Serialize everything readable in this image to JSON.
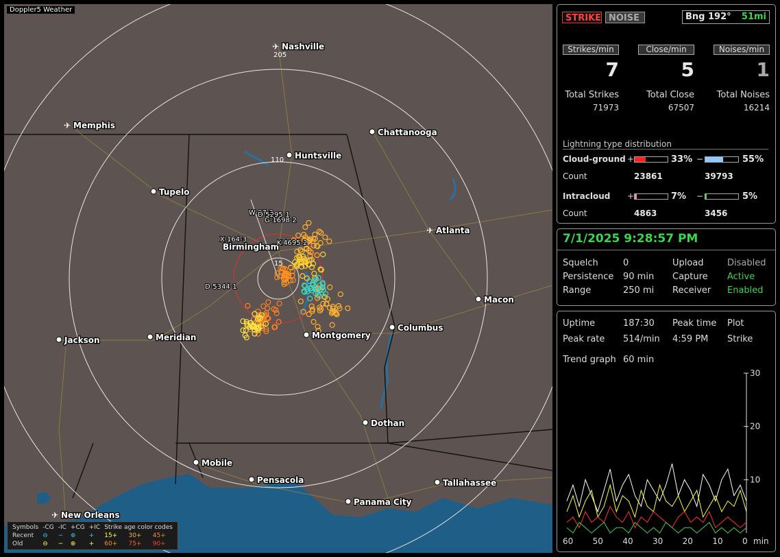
{
  "app": {
    "title": "Doppler5 Weather"
  },
  "map": {
    "range_labels": [
      "205",
      "110",
      "15"
    ],
    "cities": [
      {
        "name": "Nashville",
        "kind": "airport"
      },
      {
        "name": "Memphis",
        "kind": "airport"
      },
      {
        "name": "Chattanooga",
        "kind": "city"
      },
      {
        "name": "Huntsville",
        "kind": "city"
      },
      {
        "name": "Tupelo",
        "kind": "city"
      },
      {
        "name": "Atlanta",
        "kind": "airport"
      },
      {
        "name": "Birmingham",
        "kind": "city"
      },
      {
        "name": "Macon",
        "kind": "city"
      },
      {
        "name": "Columbus",
        "kind": "city"
      },
      {
        "name": "Montgomery",
        "kind": "city"
      },
      {
        "name": "Meridian",
        "kind": "city"
      },
      {
        "name": "Jackson",
        "kind": "city"
      },
      {
        "name": "Dothan",
        "kind": "city"
      },
      {
        "name": "Mobile",
        "kind": "city"
      },
      {
        "name": "Pensacola",
        "kind": "city"
      },
      {
        "name": "Tallahassee",
        "kind": "city"
      },
      {
        "name": "Panama City",
        "kind": "city"
      },
      {
        "name": "New Orleans",
        "kind": "airport"
      }
    ],
    "cell_labels": [
      "W-87-3",
      "D-5295-1",
      "G-1698-2",
      "X-164-3",
      "K-4695-2",
      "D-5344-1"
    ],
    "legend": {
      "symbols_label": "Symbols",
      "cols": [
        "-CG",
        "-IC",
        "+CG",
        "+IC"
      ],
      "age_label": "Strike age color codes",
      "recent_label": "Recent",
      "old_label": "Old",
      "recent_ages": [
        "15+",
        "30+",
        "45+"
      ],
      "old_ages": [
        "60+",
        "75+",
        "90+"
      ]
    }
  },
  "panel": {
    "strike_btn": "STRIKE",
    "noise_btn": "NOISE",
    "bearing": "Bng 192°",
    "bearing_dist": "51mi",
    "rate_labels": [
      "Strikes/min",
      "Close/min",
      "Noises/min"
    ],
    "rate_values": [
      "7",
      "5",
      "1"
    ],
    "total_labels": [
      "Total Strikes",
      "Total Close",
      "Total Noises"
    ],
    "total_values": [
      "71973",
      "67507",
      "16214"
    ],
    "dist_title": "Lightning type distribution",
    "cg_label": "Cloud-ground",
    "ic_label": "Intracloud",
    "count_label": "Count",
    "plus": "+",
    "minus": "−",
    "cg_pos_pct": "33%",
    "cg_neg_pct": "55%",
    "cg_pos_count": "23861",
    "cg_neg_count": "39793",
    "ic_pos_pct": "7%",
    "ic_neg_pct": "5%",
    "ic_pos_count": "4863",
    "ic_neg_count": "3456",
    "cg_pos_frac": 0.33,
    "cg_neg_frac": 0.55,
    "ic_pos_frac": 0.07,
    "ic_neg_frac": 0.05
  },
  "status": {
    "datetime": "7/1/2025 9:28:57 PM",
    "squelch_label": "Squelch",
    "squelch": "0",
    "persistence_label": "Persistence",
    "persistence": "90 min",
    "range_label": "Range",
    "range": "250 mi",
    "upload_label": "Upload",
    "upload": "Disabled",
    "capture_label": "Capture",
    "capture": "Active",
    "receiver_label": "Receiver",
    "receiver": "Enabled"
  },
  "stats": {
    "uptime_label": "Uptime",
    "uptime": "187:30",
    "peak_time_label": "Peak time",
    "peak_time": "4:59 PM",
    "plot_label": "Plot",
    "plot": "Strike",
    "peak_rate_label": "Peak rate",
    "peak_rate": "514/min",
    "trend_label": "Trend graph",
    "trend": "60 min"
  },
  "chart_data": {
    "type": "line",
    "x_ticks": [
      "60",
      "50",
      "40",
      "30",
      "20",
      "10",
      "0"
    ],
    "x_unit": "min",
    "y_ticks": [
      "30",
      "20",
      "10"
    ],
    "ylim": [
      0,
      30
    ],
    "xlim": [
      60,
      0
    ],
    "series": [
      {
        "color": "#ffffff",
        "values": [
          6,
          9,
          5,
          10,
          7,
          4,
          8,
          12,
          6,
          9,
          11,
          7,
          5,
          10,
          8,
          6,
          9,
          13,
          7,
          10,
          8,
          5,
          11,
          9,
          6,
          10,
          12,
          7,
          9,
          6
        ]
      },
      {
        "color": "#ffff3c",
        "values": [
          4,
          7,
          3,
          6,
          8,
          3,
          5,
          9,
          4,
          7,
          6,
          3,
          8,
          5,
          4,
          9,
          6,
          5,
          7,
          4,
          6,
          8,
          3,
          5,
          7,
          4,
          6,
          5,
          8,
          4
        ]
      },
      {
        "color": "#ff3030",
        "values": [
          2,
          3,
          1,
          4,
          2,
          3,
          2,
          5,
          3,
          2,
          4,
          1,
          3,
          2,
          4,
          3,
          2,
          1,
          3,
          4,
          2,
          3,
          2,
          4,
          1,
          2,
          3,
          2,
          1,
          2
        ]
      },
      {
        "color": "#3cd44c",
        "values": [
          1,
          0,
          2,
          1,
          0,
          1,
          2,
          0,
          1,
          1,
          0,
          2,
          1,
          0,
          1,
          0,
          2,
          1,
          0,
          1,
          1,
          0,
          1,
          2,
          0,
          1,
          0,
          1,
          0,
          1
        ]
      }
    ]
  },
  "colors": {
    "accent_green": "#3cd44c",
    "strike_red": "#ff4040",
    "cg_pos": "#ff2020",
    "cg_neg": "#8fc8ff",
    "ic_pos": "#ff80c0",
    "ic_neg": "#3cd44c"
  }
}
